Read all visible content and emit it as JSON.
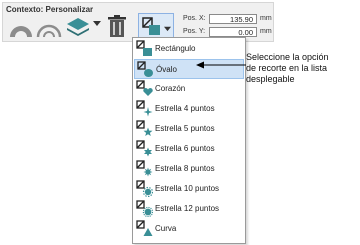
{
  "toolbar": {
    "context_label": "Contexto: Personalizar",
    "pos_x_label": "Pos. X:",
    "pos_x_value": "135.90",
    "pos_y_label": "Pos. Y:",
    "pos_y_value": "0.00",
    "unit": "mm"
  },
  "dropdown": {
    "items": [
      {
        "label": "Rectángulo",
        "icon": "rectangle-icon"
      },
      {
        "label": "Óvalo",
        "icon": "oval-icon",
        "selected": true
      },
      {
        "label": "Corazón",
        "icon": "heart-icon"
      },
      {
        "label": "Estrella 4 puntos",
        "icon": "star-4-icon"
      },
      {
        "label": "Estrella 5 puntos",
        "icon": "star-5-icon"
      },
      {
        "label": "Estrella 6 puntos",
        "icon": "star-6-icon"
      },
      {
        "label": "Estrella 8 puntos",
        "icon": "star-8-icon"
      },
      {
        "label": "Estrella 10 puntos",
        "icon": "star-10-icon"
      },
      {
        "label": "Estrella 12 puntos",
        "icon": "star-12-icon"
      },
      {
        "label": "Curva",
        "icon": "curve-icon"
      }
    ]
  },
  "callout": {
    "line1": "Seleccione la opción",
    "line2": "de recorte en la lista",
    "line3": "desplegable"
  },
  "colors": {
    "icon_teal": "#3a8f96",
    "selection_bg": "#cfe2f6",
    "toolbar_bg": "#f0f0f0"
  }
}
